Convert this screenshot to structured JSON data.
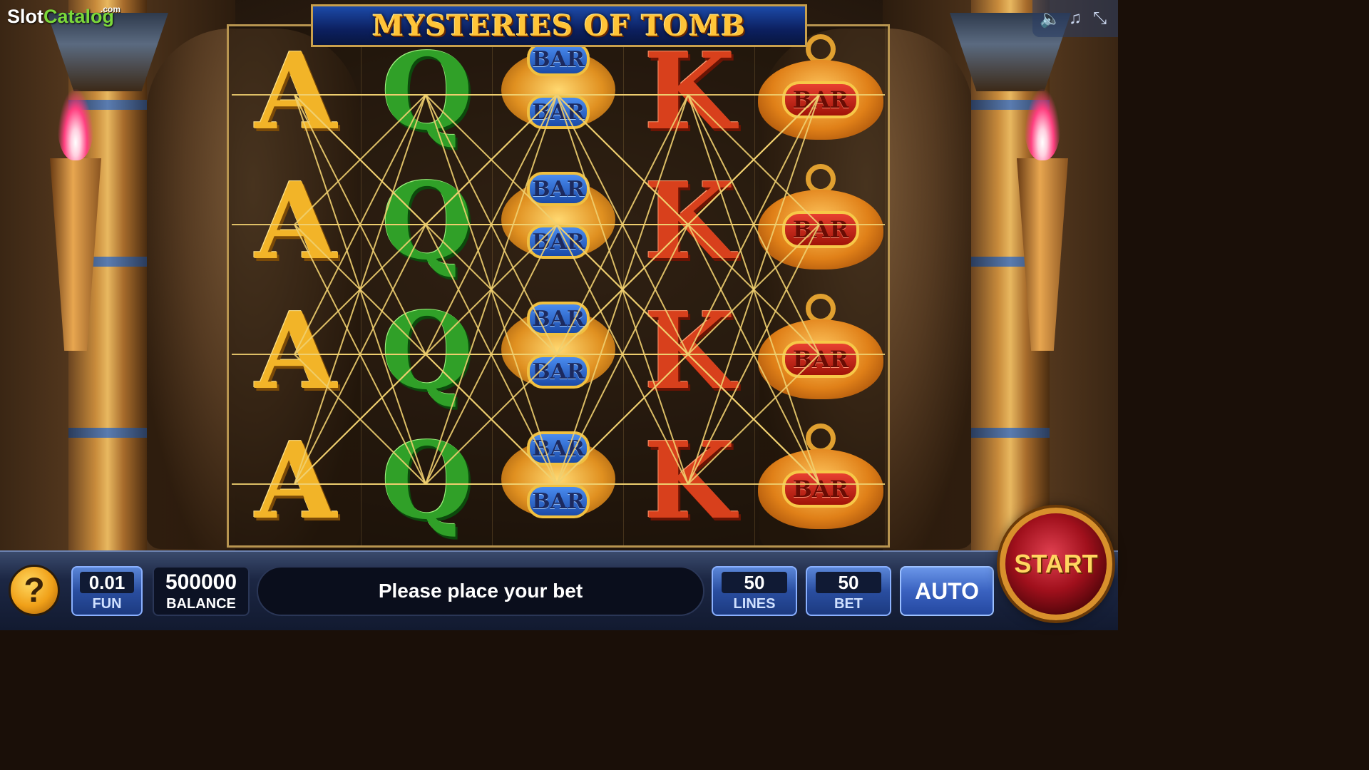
{
  "watermark": {
    "main": "Slot",
    "accent": "Catalog",
    "suffix": ".com"
  },
  "title": "MYSTERIES OF TOMB",
  "system_controls": [
    {
      "name": "sound-icon",
      "glyph": "🔈"
    },
    {
      "name": "music-icon",
      "glyph": "♫"
    },
    {
      "name": "minimize-icon",
      "glyph": "⤡"
    }
  ],
  "reels": [
    [
      "A",
      "A",
      "A",
      "A"
    ],
    [
      "Q",
      "Q",
      "Q",
      "Q"
    ],
    [
      "BAR-BLUE",
      "BAR-BLUE",
      "BAR-BLUE",
      "BAR-BLUE"
    ],
    [
      "K",
      "K",
      "K",
      "K"
    ],
    [
      "BAR-RED",
      "BAR-RED",
      "BAR-RED",
      "BAR-RED"
    ]
  ],
  "symbol_text": {
    "bar": "BAR"
  },
  "panel": {
    "help_label": "?",
    "coin": {
      "value": "0.01",
      "label": "FUN"
    },
    "balance": {
      "value": "500000",
      "label": "BALANCE"
    },
    "message": "Please place your bet",
    "lines": {
      "value": "50",
      "label": "LINES"
    },
    "bet": {
      "value": "50",
      "label": "BET"
    },
    "auto_label": "AUTO",
    "start_label": "START"
  },
  "colors": {
    "title_gold": "#ffc438",
    "payline": "#f0d070",
    "panel_blue": "#2a4ea0"
  }
}
